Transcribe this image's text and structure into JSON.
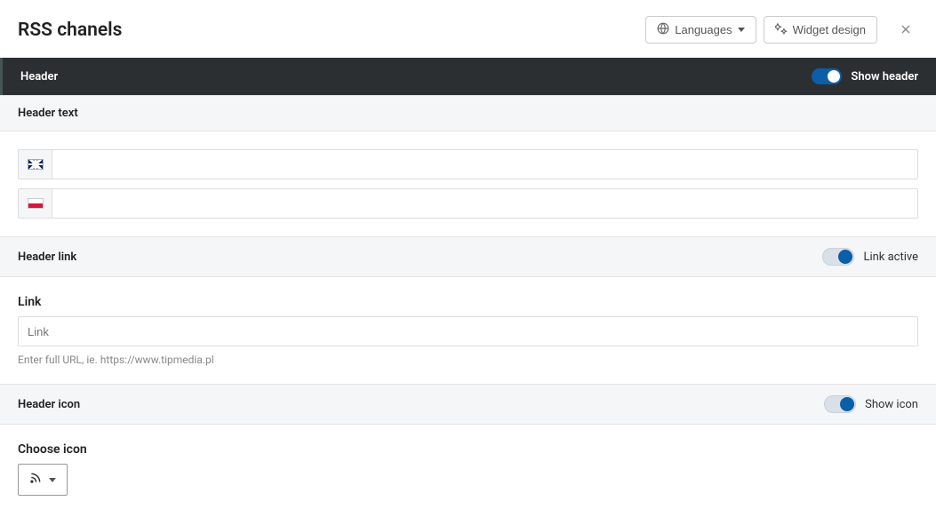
{
  "page": {
    "title": "RSS chanels"
  },
  "topButtons": {
    "languages": "Languages",
    "widgetDesign": "Widget design"
  },
  "header": {
    "label": "Header",
    "showHeaderLabel": "Show header",
    "showHeaderOn": true
  },
  "headerText": {
    "label": "Header text",
    "en_value": "",
    "pl_value": ""
  },
  "headerLink": {
    "label": "Header link",
    "activeLabel": "Link active",
    "activeOn": true,
    "linkFieldLabel": "Link",
    "linkPlaceholder": "Link",
    "linkValue": "",
    "hint": "Enter full URL, ie. https://www.tipmedia.pl"
  },
  "headerIcon": {
    "label": "Header icon",
    "showIconLabel": "Show icon",
    "showIconOn": true,
    "chooseLabel": "Choose icon",
    "selectedIcon": "rss"
  }
}
